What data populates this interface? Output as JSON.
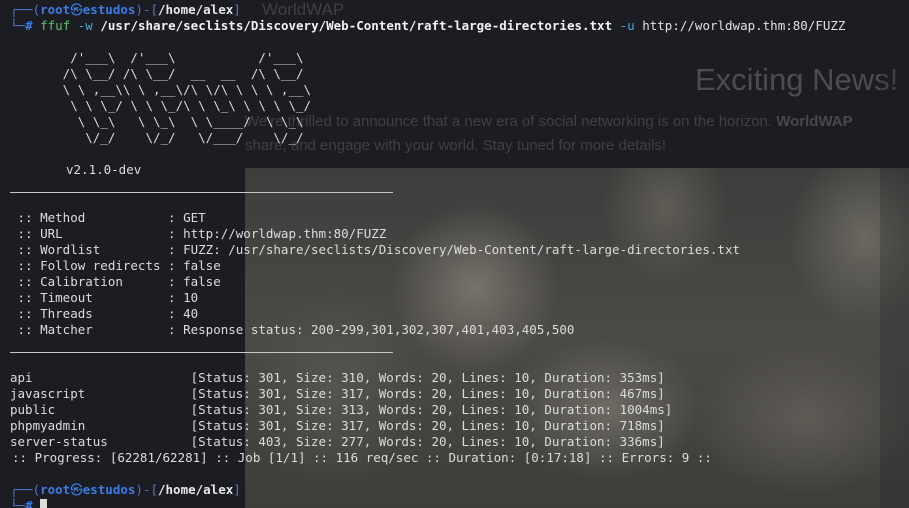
{
  "background_window": {
    "brand": "WorldWAP",
    "heading": "Exciting News!",
    "paragraph_line1": "We're thrilled to announce that a new era of social networking is on the horizon.",
    "paragraph_bold": "WorldWAP",
    "paragraph_line2": "share, and engage with your world. Stay tuned for more details!"
  },
  "prompt": {
    "top_left": "┌──(",
    "user": "root",
    "skull": "㉿",
    "host": "estudos",
    "mid": ")-[",
    "cwd": "/home/alex",
    "close": "]",
    "bottom_left": "└─",
    "hash": "#"
  },
  "command": {
    "binary": "ffuf",
    "flag_w": "-w",
    "wordlist": "/usr/share/seclists/Discovery/Web-Content/raft-large-directories.txt",
    "flag_u": "-u",
    "url": "http://worldwap.thm:80/FUZZ"
  },
  "banner": {
    "lines": [
      "        /'___\\  /'___\\           /'___\\",
      "       /\\ \\__/ /\\ \\__/  __  __  /\\ \\__/",
      "       \\ \\ ,__\\\\ \\ ,__\\/\\ \\/\\ \\ \\ \\ ,__\\",
      "        \\ \\ \\_/ \\ \\ \\_/\\ \\ \\_\\ \\ \\ \\ \\_/",
      "         \\ \\_\\   \\ \\_\\  \\ \\____/  \\ \\_\\",
      "          \\/_/    \\/_/   \\/___/    \\/_/"
    ],
    "version": "v2.1.0-dev"
  },
  "config": [
    {
      "key": " :: Method           ",
      "value": ": GET"
    },
    {
      "key": " :: URL              ",
      "value": ": http://worldwap.thm:80/FUZZ"
    },
    {
      "key": " :: Wordlist         ",
      "value": ": FUZZ: /usr/share/seclists/Discovery/Web-Content/raft-large-directories.txt"
    },
    {
      "key": " :: Follow redirects ",
      "value": ": false"
    },
    {
      "key": " :: Calibration      ",
      "value": ": false"
    },
    {
      "key": " :: Timeout          ",
      "value": ": 10"
    },
    {
      "key": " :: Threads          ",
      "value": ": 40"
    },
    {
      "key": " :: Matcher          ",
      "value": ": Response status: 200-299,301,302,307,401,403,405,500"
    }
  ],
  "results": [
    {
      "path": "api                     ",
      "info": "[Status: 301, Size: 310, Words: 20, Lines: 10, Duration: 353ms]"
    },
    {
      "path": "javascript              ",
      "info": "[Status: 301, Size: 317, Words: 20, Lines: 10, Duration: 467ms]"
    },
    {
      "path": "public                  ",
      "info": "[Status: 301, Size: 313, Words: 20, Lines: 10, Duration: 1004ms]"
    },
    {
      "path": "phpmyadmin              ",
      "info": "[Status: 301, Size: 317, Words: 20, Lines: 10, Duration: 718ms]"
    },
    {
      "path": "server-status           ",
      "info": "[Status: 403, Size: 277, Words: 20, Lines: 10, Duration: 336ms]"
    }
  ],
  "progress": ":: Progress: [62281/62281] :: Job [1/1] :: 116 req/sec :: Duration: [0:17:18] :: Errors: 9 ::",
  "colors": {
    "background": "#1b1d22",
    "prompt_frame": "#4a7bd1",
    "prompt_user": "#3d7be8",
    "command": "#5ec26f",
    "flag": "#4aa6d9",
    "text": "#dcdcdc"
  }
}
